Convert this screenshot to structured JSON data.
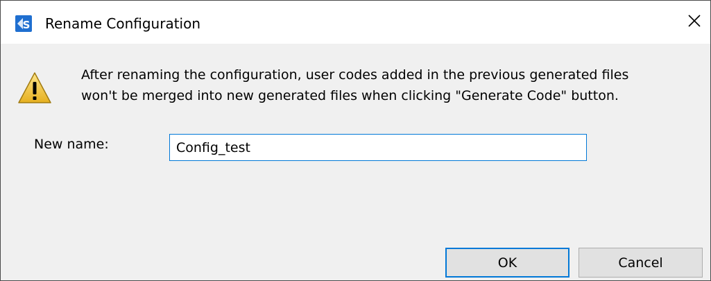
{
  "window": {
    "title": "Rename Configuration",
    "icon": "app-logo-icon",
    "close_icon": "close-icon"
  },
  "message": {
    "icon": "warning-icon",
    "line1": "After renaming the configuration, user codes added in the previous generated files",
    "line2": "won't be merged into new generated files when clicking \"Generate Code\" button."
  },
  "form": {
    "name_label": "New name:",
    "name_value": "Config_test"
  },
  "buttons": {
    "ok_label": "OK",
    "cancel_label": "Cancel"
  },
  "colors": {
    "accent": "#0078d7",
    "dialog_bg": "#f0f0f0",
    "button_bg": "#e1e1e1"
  }
}
